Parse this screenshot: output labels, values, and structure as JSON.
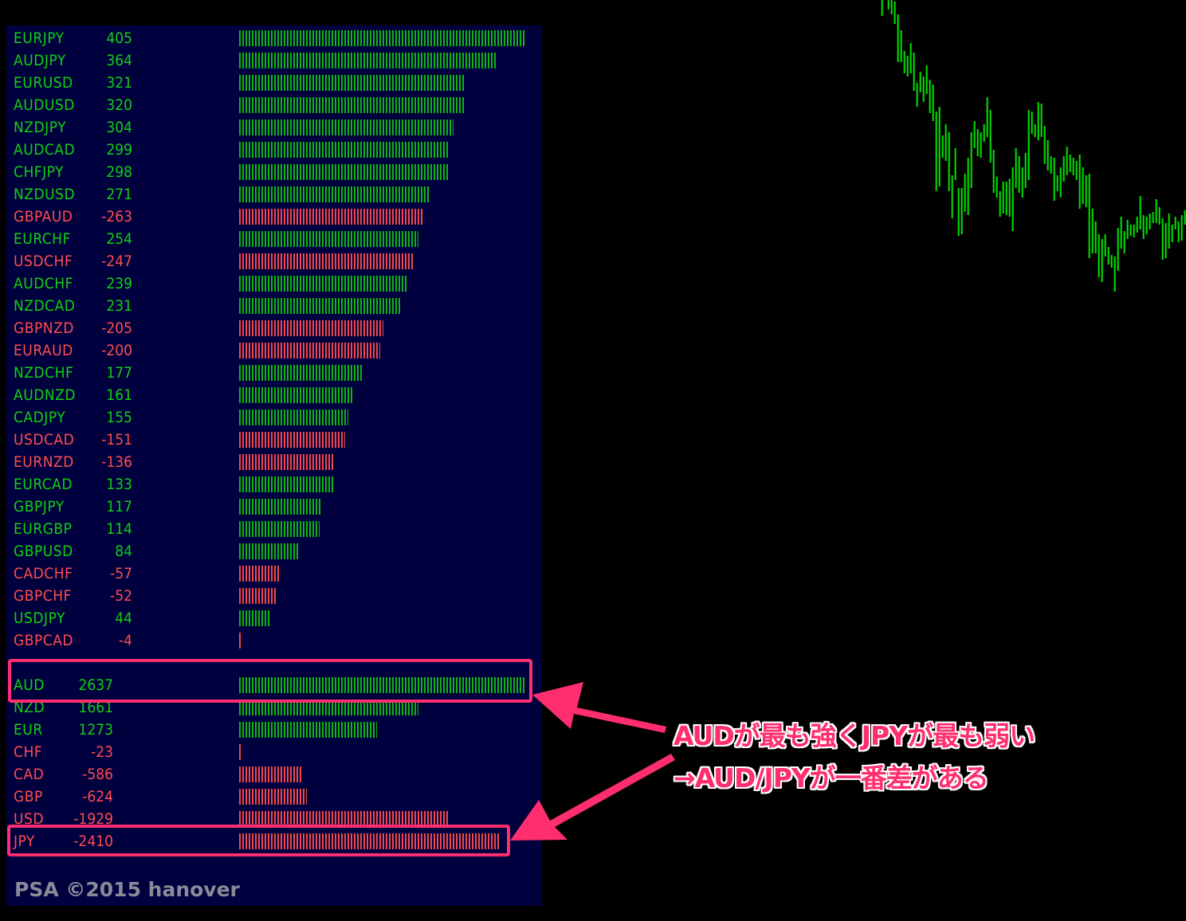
{
  "colors": {
    "positive": "#11d011",
    "negative": "#ff4d4d",
    "panel_bg": "#00003f",
    "annotation": "#ff2e6e",
    "price_bars": "#00e600"
  },
  "pairs": [
    {
      "name": "EURJPY",
      "value": 405
    },
    {
      "name": "AUDJPY",
      "value": 364
    },
    {
      "name": "EURUSD",
      "value": 321
    },
    {
      "name": "AUDUSD",
      "value": 320
    },
    {
      "name": "NZDJPY",
      "value": 304
    },
    {
      "name": "AUDCAD",
      "value": 299
    },
    {
      "name": "CHFJPY",
      "value": 298
    },
    {
      "name": "NZDUSD",
      "value": 271
    },
    {
      "name": "GBPAUD",
      "value": -263
    },
    {
      "name": "EURCHF",
      "value": 254
    },
    {
      "name": "USDCHF",
      "value": -247
    },
    {
      "name": "AUDCHF",
      "value": 239
    },
    {
      "name": "NZDCAD",
      "value": 231
    },
    {
      "name": "GBPNZD",
      "value": -205
    },
    {
      "name": "EURAUD",
      "value": -200
    },
    {
      "name": "NZDCHF",
      "value": 177
    },
    {
      "name": "AUDNZD",
      "value": 161
    },
    {
      "name": "CADJPY",
      "value": 155
    },
    {
      "name": "USDCAD",
      "value": -151
    },
    {
      "name": "EURNZD",
      "value": -136
    },
    {
      "name": "EURCAD",
      "value": 133
    },
    {
      "name": "GBPJPY",
      "value": 117
    },
    {
      "name": "EURGBP",
      "value": 114
    },
    {
      "name": "GBPUSD",
      "value": 84
    },
    {
      "name": "CADCHF",
      "value": -57
    },
    {
      "name": "GBPCHF",
      "value": -52
    },
    {
      "name": "USDJPY",
      "value": 44
    },
    {
      "name": "GBPCAD",
      "value": -4
    }
  ],
  "currencies": [
    {
      "name": "AUD",
      "value": 2637
    },
    {
      "name": "NZD",
      "value": 1661
    },
    {
      "name": "EUR",
      "value": 1273
    },
    {
      "name": "CHF",
      "value": -23
    },
    {
      "name": "CAD",
      "value": -586
    },
    {
      "name": "GBP",
      "value": -624
    },
    {
      "name": "USD",
      "value": -1929
    },
    {
      "name": "JPY",
      "value": -2410
    }
  ],
  "credit": "PSA ©2015 hanover",
  "annotation": {
    "line1": "AUDが最も強くJPYが最も弱い",
    "line2": "→AUD/JPYが一番差がある",
    "highlighted": [
      "AUD",
      "JPY"
    ]
  }
}
